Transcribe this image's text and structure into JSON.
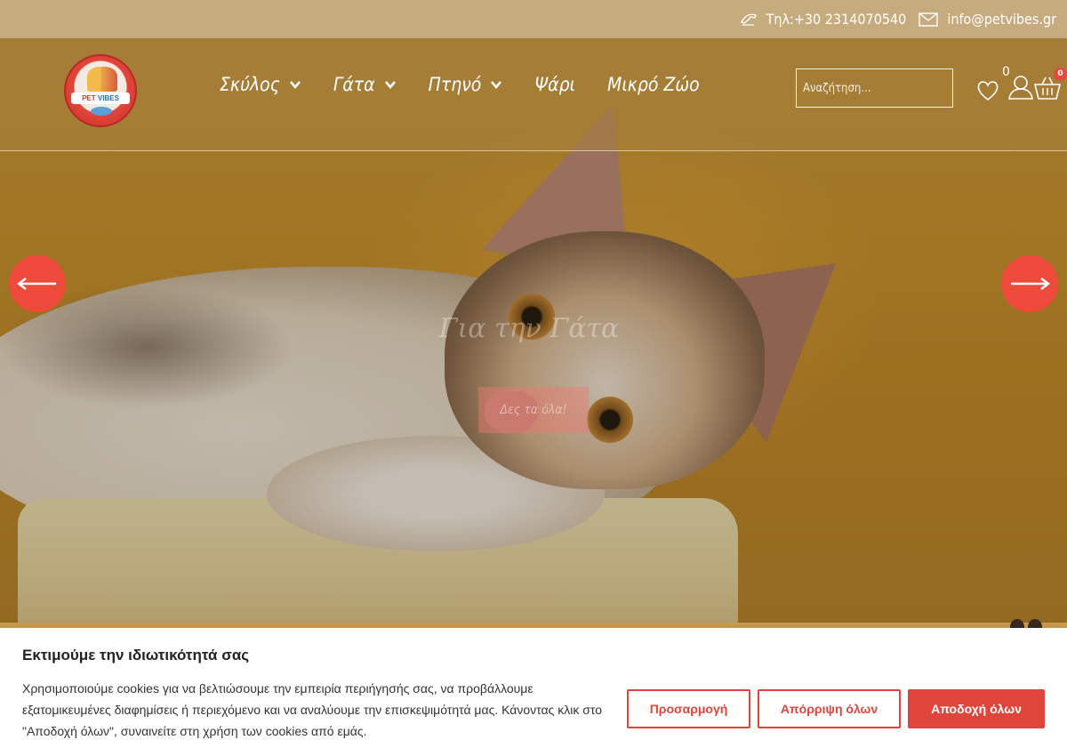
{
  "topbar": {
    "phone": "Τηλ:+30 2314070540",
    "email": "info@petvibes.gr"
  },
  "logo": {
    "line1": "PET",
    "line2": "VIBES"
  },
  "nav": [
    {
      "label": "Σκύλος",
      "has_dropdown": true
    },
    {
      "label": "Γάτα",
      "has_dropdown": true
    },
    {
      "label": "Πτηνό",
      "has_dropdown": true
    },
    {
      "label": "Ψάρι",
      "has_dropdown": false
    },
    {
      "label": "Μικρό Ζώο",
      "has_dropdown": false
    }
  ],
  "search": {
    "placeholder": "Αναζήτηση..."
  },
  "wishlist": {
    "count": "0"
  },
  "cart": {
    "count": "0"
  },
  "slide": {
    "title": "Για την Γάτα",
    "button": "Δες τα όλα!"
  },
  "cookie": {
    "title": "Εκτιμούμε την ιδιωτικότητά σας",
    "text": "Χρησιμοποιούμε cookies για να βελτιώσουμε την εμπειρία περιήγησής σας, να προβάλλουμε εξατομικευμένες διαφημίσεις ή περιεχόμενο και να αναλύουμε την επισκεψιμότητά μας. Κάνοντας κλικ στο \"Αποδοχή όλων\", συναινείτε στη χρήση των cookies από εμάς.",
    "customize": "Προσαρμογή",
    "reject": "Απόρριψη όλων",
    "accept": "Αποδοχή όλων"
  },
  "colors": {
    "accent": "#e0453b",
    "topbar_text": "#ffffff"
  },
  "icons": [
    "phone-icon",
    "mail-icon",
    "heart-icon",
    "user-icon",
    "cart-icon",
    "chevron-down-icon",
    "arrow-left-icon",
    "arrow-right-icon"
  ]
}
